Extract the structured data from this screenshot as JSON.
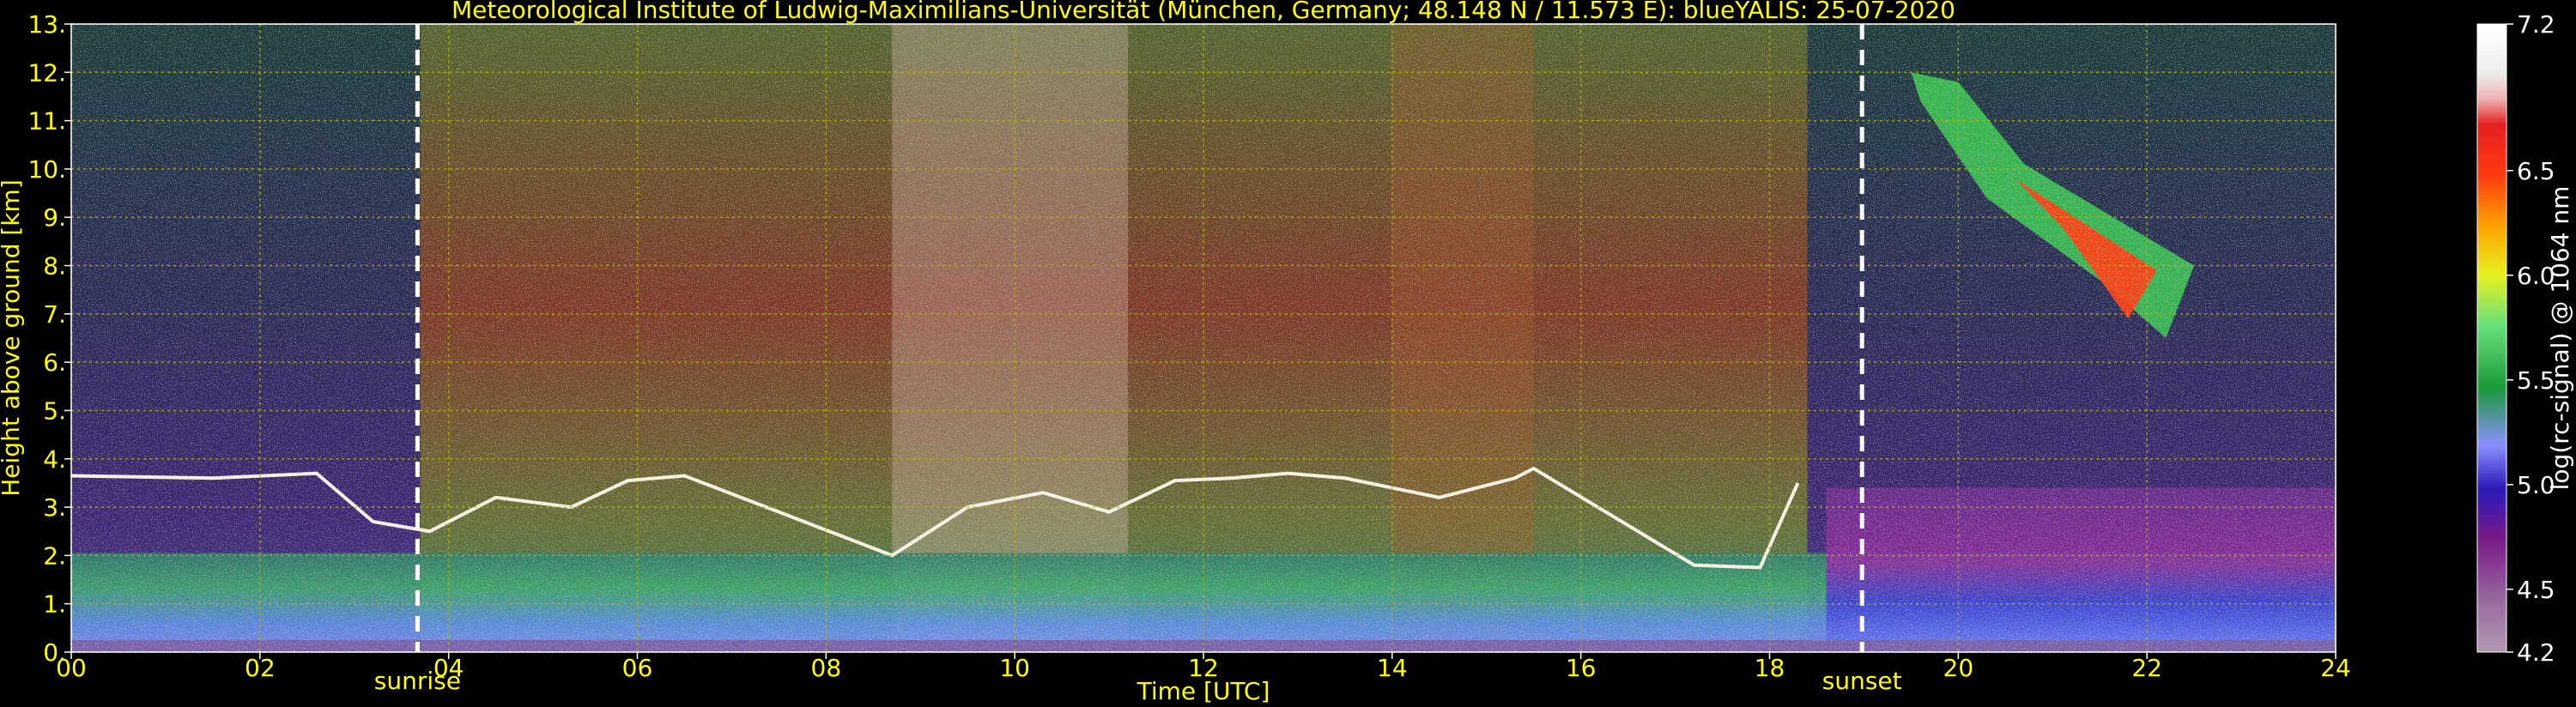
{
  "chart_data": {
    "type": "heatmap",
    "title": "Meteorological Institute of Ludwig-Maximilians-Universität (München, Germany; 48.148 N / 11.573 E):    blueYALIS: 25-07-2020",
    "xlabel": "Time [UTC]",
    "ylabel": "Height above ground [km]",
    "xlim": [
      0,
      24
    ],
    "ylim": [
      0,
      13
    ],
    "x_ticks": [
      "00",
      "02",
      "04",
      "06",
      "08",
      "10",
      "12",
      "14",
      "16",
      "18",
      "20",
      "22",
      "24"
    ],
    "y_ticks": [
      "0.",
      "1.",
      "2.",
      "3.",
      "4.",
      "5.",
      "6.",
      "7.",
      "8.",
      "9.",
      "10.",
      "11.",
      "12.",
      "13."
    ],
    "grid": true,
    "annotations": [
      {
        "label": "sunrise",
        "x": 3.67
      },
      {
        "label": "sunset",
        "x": 18.98
      }
    ],
    "colorbar": {
      "label": "log(rc-signal) @ 1064 nm",
      "range": [
        4.2,
        7.2
      ],
      "tick_labels": [
        "7.2",
        "6.5",
        "6.0",
        "5.5",
        "5.0",
        "4.5",
        "4.2"
      ],
      "tick_values": [
        7.2,
        6.5,
        6.0,
        5.5,
        5.0,
        4.5,
        4.2
      ]
    },
    "features": [
      {
        "type": "boundary_layer_top",
        "points": [
          [
            0,
            3.65
          ],
          [
            1.5,
            3.6
          ],
          [
            2.6,
            3.7
          ],
          [
            3.2,
            2.7
          ],
          [
            3.8,
            2.5
          ],
          [
            4.5,
            3.2
          ],
          [
            5.3,
            3.0
          ],
          [
            5.9,
            3.55
          ],
          [
            6.5,
            3.65
          ],
          [
            8.7,
            2.0
          ],
          [
            9.5,
            3.0
          ],
          [
            10.3,
            3.3
          ],
          [
            11.0,
            2.9
          ],
          [
            11.7,
            3.55
          ],
          [
            12.3,
            3.6
          ],
          [
            12.9,
            3.7
          ],
          [
            13.5,
            3.6
          ],
          [
            14.5,
            3.2
          ],
          [
            15.3,
            3.6
          ],
          [
            15.5,
            3.8
          ],
          [
            17.2,
            1.8
          ],
          [
            17.9,
            1.75
          ],
          [
            18.3,
            3.5
          ]
        ]
      },
      {
        "type": "cirrus",
        "x_range": [
          19.5,
          22.5
        ],
        "z_range": [
          6.5,
          12.0
        ]
      }
    ]
  },
  "colors": {
    "axes_text": "#ffff00",
    "grid": "#b8b800",
    "colorbar_text": "#ffffff",
    "event_line": "#ffffff"
  }
}
